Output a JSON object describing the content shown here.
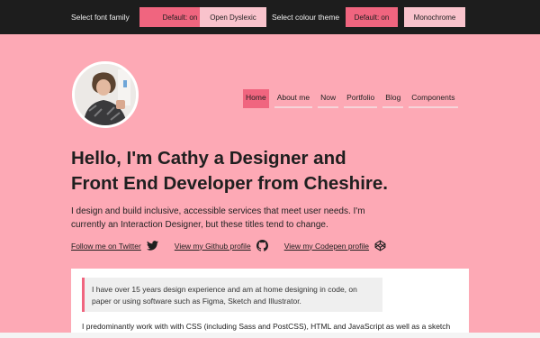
{
  "settings": {
    "font_label": "Select font family",
    "font_options": [
      "Default: on",
      "Open Dyslexic"
    ],
    "theme_label": "Select colour theme",
    "theme_options": [
      "Default: on",
      "Monochrome"
    ]
  },
  "nav": {
    "items": [
      "Home",
      "About me",
      "Now",
      "Portfolio",
      "Blog",
      "Components"
    ],
    "active": "Home"
  },
  "hero": {
    "title": "Hello, I'm Cathy a Designer and Front End Developer from Cheshire.",
    "intro": "I design and build inclusive, accessible services that meet user needs. I'm currently an Interaction Designer, but these titles tend to change."
  },
  "social": [
    {
      "label": "Follow me on Twitter",
      "icon": "twitter-icon"
    },
    {
      "label": "View my Github profile",
      "icon": "github-icon"
    },
    {
      "label": "View my Codepen profile",
      "icon": "codepen-icon"
    }
  ],
  "card": {
    "quote": "I have over 15 years design experience and am at home designing in code, on paper or using software such as Figma, Sketch and Illustrator.",
    "paragraph": "I predominantly work with with CSS (including Sass and PostCSS), HTML and JavaScript as well as a sketch pad, some post-it notes and my favourite pens."
  },
  "colors": {
    "page_bg": "#fda9b5",
    "topbar_bg": "#1d1d1d",
    "accent": "#f0657f",
    "option_off": "#f9c3cc"
  }
}
